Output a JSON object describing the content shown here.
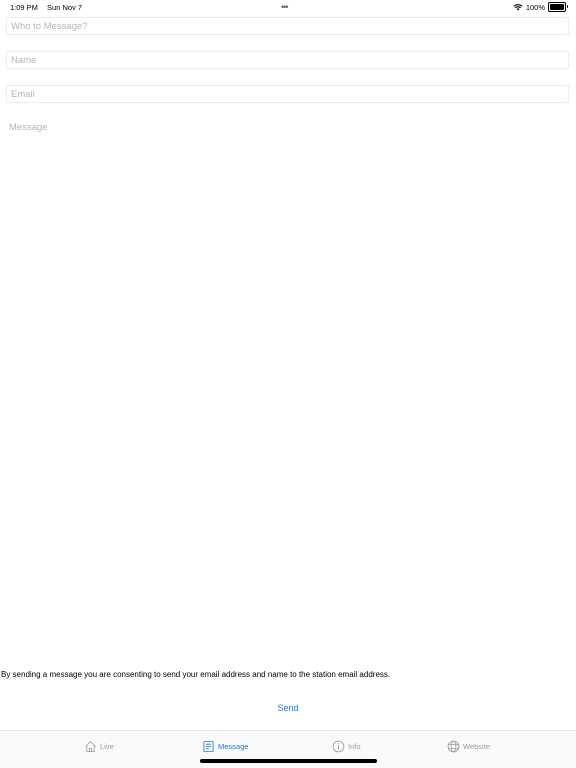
{
  "status_bar": {
    "time": "1:09 PM",
    "date": "Sun Nov 7",
    "battery": "100%",
    "battery_level": 1.0,
    "icons": [
      "wifi-icon",
      "battery-icon"
    ]
  },
  "form": {
    "recipient_placeholder": "Who to Message?",
    "name_placeholder": "Name",
    "email_placeholder": "Email",
    "message_placeholder": "Message"
  },
  "consent_text": "By sending a message you are consenting to send your email address and name to the station email address.",
  "send_label": "Send",
  "tabs": [
    {
      "label": "Live",
      "icon": "home-icon",
      "active": false
    },
    {
      "label": "Message",
      "icon": "message-icon",
      "active": true
    },
    {
      "label": "Info",
      "icon": "info-icon",
      "active": false
    },
    {
      "label": "Website",
      "icon": "globe-icon",
      "active": false
    }
  ],
  "colors": {
    "accent": "#1a7ad4",
    "inactive_tab": "#9a9a9a",
    "placeholder": "#b5b5b5"
  }
}
